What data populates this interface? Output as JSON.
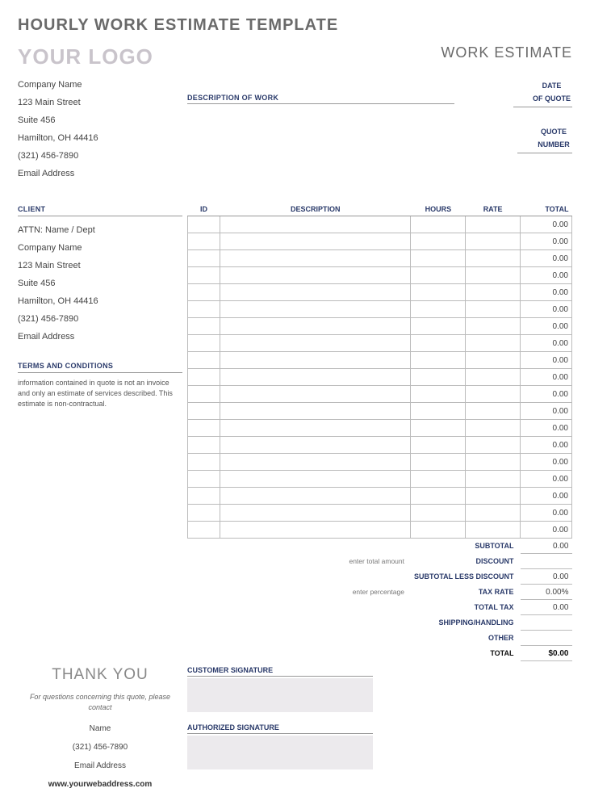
{
  "doc_title": "HOURLY WORK ESTIMATE TEMPLATE",
  "logo_text": "YOUR LOGO",
  "header_right": "WORK ESTIMATE",
  "desc_label": "DESCRIPTION OF WORK",
  "meta": {
    "date_l1": "DATE",
    "date_l2": "OF QUOTE",
    "qn_l1": "QUOTE",
    "qn_l2": "NUMBER"
  },
  "company": {
    "name": "Company Name",
    "street": "123 Main Street",
    "suite": "Suite 456",
    "city": "Hamilton, OH  44416",
    "phone": "(321) 456-7890",
    "email": "Email Address"
  },
  "client_heading": "CLIENT",
  "client": {
    "attn": "ATTN: Name / Dept",
    "name": "Company Name",
    "street": "123 Main Street",
    "suite": "Suite 456",
    "city": "Hamilton, OH  44416",
    "phone": "(321) 456-7890",
    "email": "Email Address"
  },
  "terms_heading": "TERMS AND CONDITIONS",
  "terms_text": "information contained in quote is not an invoice and only an estimate of services described. This estimate is non-contractual.",
  "columns": {
    "id": "ID",
    "desc": "DESCRIPTION",
    "hours": "HOURS",
    "rate": "RATE",
    "total": "TOTAL"
  },
  "row_total_default": "0.00",
  "row_count": 19,
  "totals": {
    "subtotal_label": "SUBTOTAL",
    "subtotal": "0.00",
    "discount_hint": "enter total amount",
    "discount_label": "DISCOUNT",
    "discount": "",
    "subless_label": "SUBTOTAL LESS DISCOUNT",
    "subless": "0.00",
    "taxrate_hint": "enter percentage",
    "taxrate_label": "TAX RATE",
    "taxrate": "0.00%",
    "totaltax_label": "TOTAL TAX",
    "totaltax": "0.00",
    "shipping_label": "SHIPPING/HANDLING",
    "shipping": "",
    "other_label": "OTHER",
    "other": "",
    "grand_label": "TOTAL",
    "grand": "$0.00"
  },
  "thank_you": "THANK YOU",
  "thank_sub": "For questions concerning this quote, please contact",
  "contact": {
    "name": "Name",
    "phone": "(321) 456-7890",
    "email": "Email Address",
    "web": "www.yourwebaddress.com"
  },
  "sig": {
    "customer": "CUSTOMER SIGNATURE",
    "authorized": "AUTHORIZED SIGNATURE"
  }
}
